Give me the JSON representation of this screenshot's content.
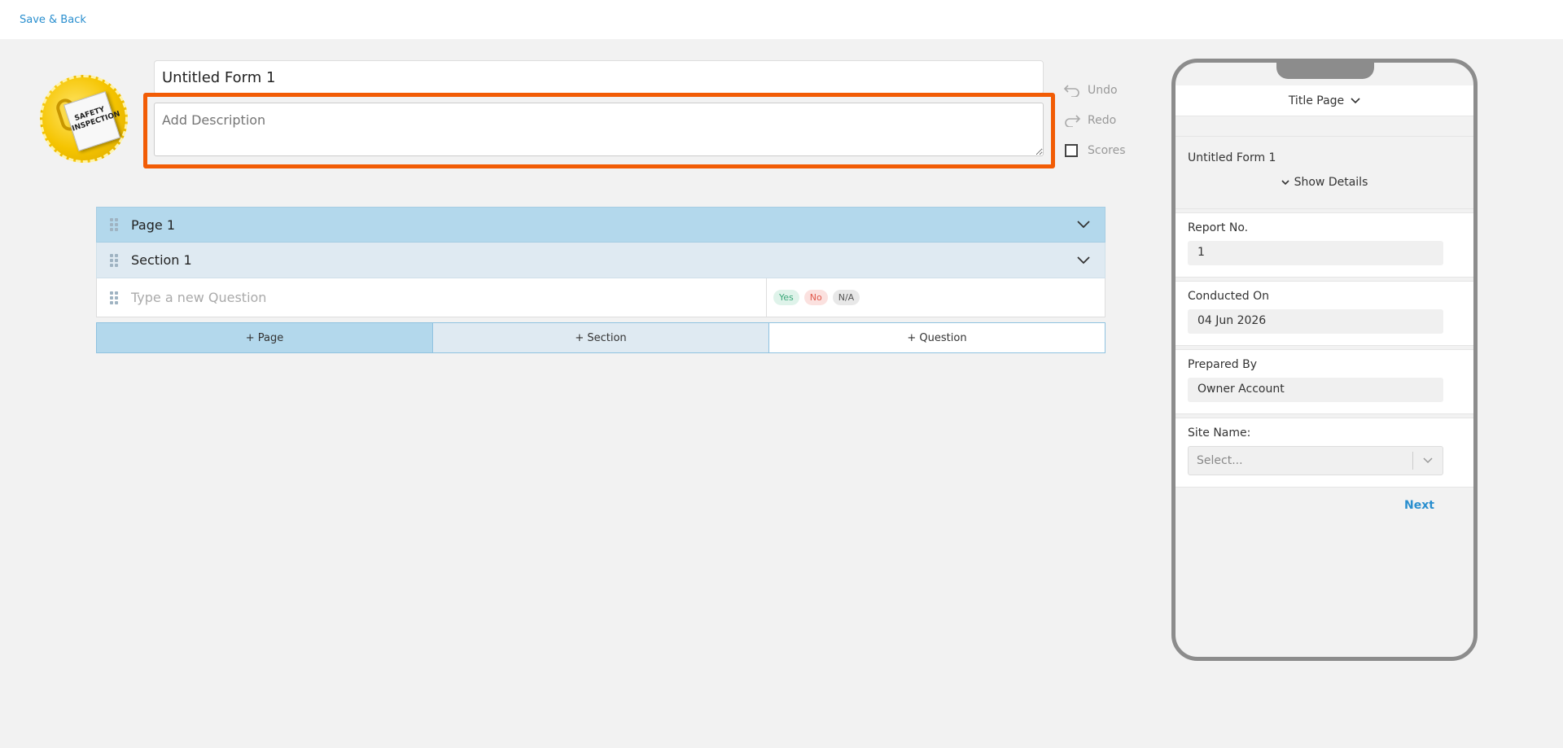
{
  "topbar": {
    "save_back": "Save & Back"
  },
  "form": {
    "title": "Untitled Form 1",
    "description_placeholder": "Add Description",
    "logo_text_line1": "SAFETY",
    "logo_text_line2": "INSPECTION"
  },
  "actions": {
    "undo": "Undo",
    "redo": "Redo",
    "scores": "Scores"
  },
  "builder": {
    "page_label": "Page 1",
    "section_label": "Section 1",
    "question_placeholder": "Type a new Question",
    "answers": {
      "yes": "Yes",
      "no": "No",
      "na": "N/A"
    },
    "add_page": "+ Page",
    "add_section": "+ Section",
    "add_question": "+ Question"
  },
  "preview": {
    "header": "Title Page",
    "form_title": "Untitled Form 1",
    "show_details": "Show Details",
    "report_no_label": "Report No.",
    "report_no_value": "1",
    "conducted_on_label": "Conducted On",
    "conducted_on_value": "04 Jun 2026",
    "prepared_by_label": "Prepared By",
    "prepared_by_value": "Owner Account",
    "site_name_label": "Site Name:",
    "site_name_placeholder": "Select...",
    "next": "Next"
  },
  "colors": {
    "accent": "#2a8fcf",
    "highlight": "#f25c05",
    "page_row": "#b3d8ec",
    "section_row": "#dfeaf2"
  }
}
